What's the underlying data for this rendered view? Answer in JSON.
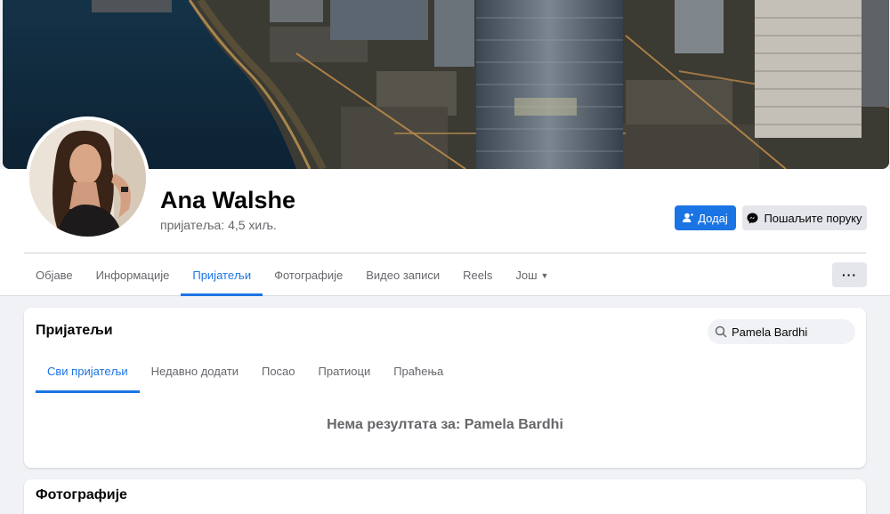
{
  "profile": {
    "name": "Ana Walshe",
    "friends_count": "пријатеља: 4,5 хиљ.",
    "add_button": "Додај",
    "message_button": "Пошаљите поруку",
    "more_button": "···"
  },
  "nav": {
    "tabs": [
      {
        "label": "Објаве"
      },
      {
        "label": "Информације"
      },
      {
        "label": "Пријатељи",
        "active": true
      },
      {
        "label": "Фотографије"
      },
      {
        "label": "Видео записи"
      },
      {
        "label": "Reels"
      },
      {
        "label": "Још"
      }
    ]
  },
  "friends_section": {
    "title": "Пријатељи",
    "search_value": "Pamela Bardhi",
    "subtabs": [
      {
        "label": "Сви пријатељи",
        "active": true
      },
      {
        "label": "Недавно додати"
      },
      {
        "label": "Посао"
      },
      {
        "label": "Пратиоци"
      },
      {
        "label": "Праћења"
      }
    ],
    "no_results": "Нема резултата за: Pamela Bardhi"
  },
  "photos_section": {
    "title": "Фотографије"
  },
  "colors": {
    "accent": "#1b74e4",
    "page_bg": "#f0f2f5",
    "secondary_text": "#65676b"
  }
}
